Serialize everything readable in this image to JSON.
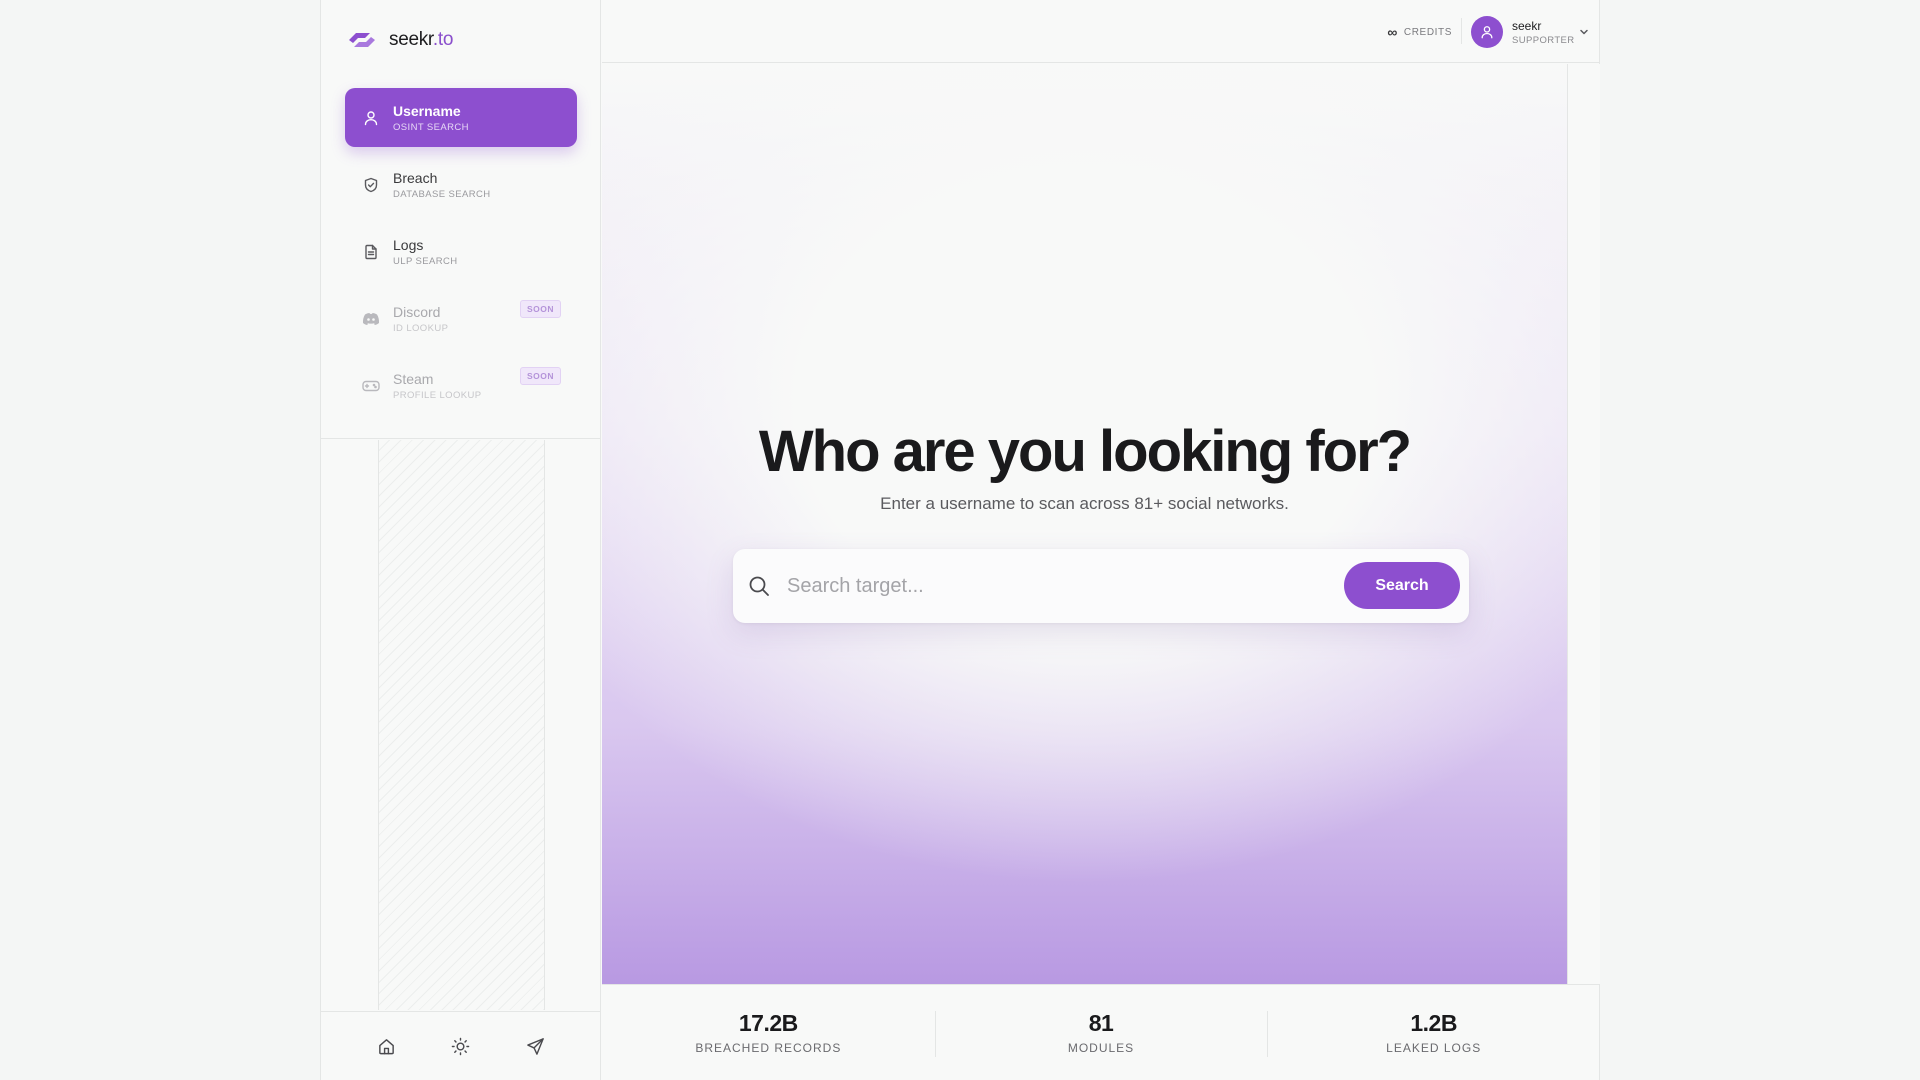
{
  "brand": {
    "name": "seekr",
    "tld": ".to",
    "color": "#8d4fcf"
  },
  "sidebar": {
    "items": [
      {
        "label": "Username",
        "sub": "OSINT SEARCH",
        "icon": "user-icon",
        "active": true
      },
      {
        "label": "Breach",
        "sub": "DATABASE SEARCH",
        "icon": "shield-icon"
      },
      {
        "label": "Logs",
        "sub": "ULP SEARCH",
        "icon": "document-icon"
      },
      {
        "label": "Discord",
        "sub": "ID LOOKUP",
        "icon": "discord-icon",
        "badge": "SOON",
        "disabled": true
      },
      {
        "label": "Steam",
        "sub": "PROFILE LOOKUP",
        "icon": "gamepad-icon",
        "badge": "SOON",
        "disabled": true
      }
    ],
    "footer": [
      {
        "icon": "home-icon"
      },
      {
        "icon": "sun-icon"
      },
      {
        "icon": "send-icon"
      }
    ]
  },
  "header": {
    "credits_symbol": "∞",
    "credits_label": "CREDITS",
    "user": {
      "name": "seekr",
      "role": "SUPPORTER"
    }
  },
  "hero": {
    "title": "Who are you looking for?",
    "subtitle": "Enter a username to scan across 81+ social networks.",
    "search": {
      "placeholder": "Search target...",
      "value": "",
      "button": "Search"
    }
  },
  "stats": [
    {
      "value": "17.2B",
      "label": "BREACHED RECORDS"
    },
    {
      "value": "81",
      "label": "MODULES"
    },
    {
      "value": "1.2B",
      "label": "LEAKED LOGS"
    }
  ]
}
